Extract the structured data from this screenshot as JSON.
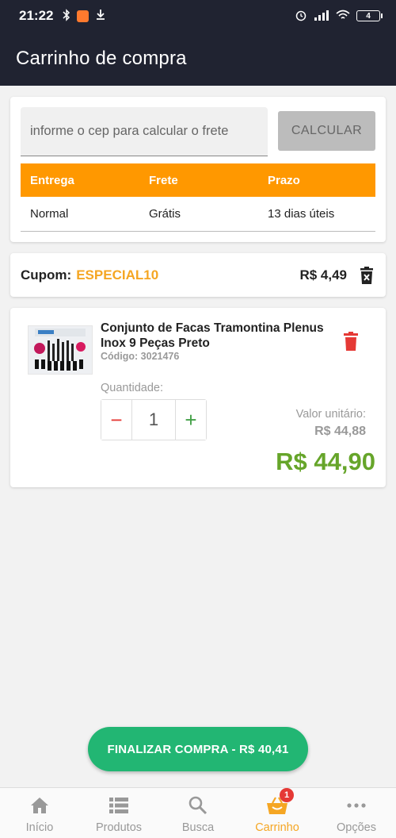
{
  "status_bar": {
    "time": "21:22",
    "battery": "4"
  },
  "header": {
    "title": "Carrinho de compra"
  },
  "shipping": {
    "cep_placeholder": "informe o cep para calcular o frete",
    "calculate_label": "CALCULAR",
    "columns": [
      "Entrega",
      "Frete",
      "Prazo"
    ],
    "rows": [
      {
        "entrega": "Normal",
        "frete": "Grátis",
        "prazo": "13 dias úteis"
      }
    ]
  },
  "coupon": {
    "label": "Cupom:",
    "code": "ESPECIAL10",
    "value": "R$ 4,49"
  },
  "product": {
    "name": "Conjunto de Facas Tramontina Plenus Inox 9 Peças Preto",
    "code": "Código: 3021476",
    "quantity_label": "Quantidade:",
    "quantity": "1",
    "minus": "−",
    "plus": "+",
    "unit_label": "Valor unitário:",
    "unit_value": "R$ 44,88",
    "total": "R$ 44,90"
  },
  "checkout": {
    "label": "FINALIZAR COMPRA - R$ 40,41"
  },
  "colors": {
    "accent": "#ff9800",
    "total_green": "#66a52a",
    "checkout_green": "#22b673",
    "delete_red": "#e53935"
  },
  "bottom_nav": {
    "items": [
      {
        "label": "Início",
        "icon": "home-icon"
      },
      {
        "label": "Produtos",
        "icon": "list-icon"
      },
      {
        "label": "Busca",
        "icon": "search-icon"
      },
      {
        "label": "Carrinho",
        "icon": "basket-icon",
        "badge": "1"
      },
      {
        "label": "Opções",
        "icon": "more-icon"
      }
    ],
    "active": "Carrinho"
  }
}
